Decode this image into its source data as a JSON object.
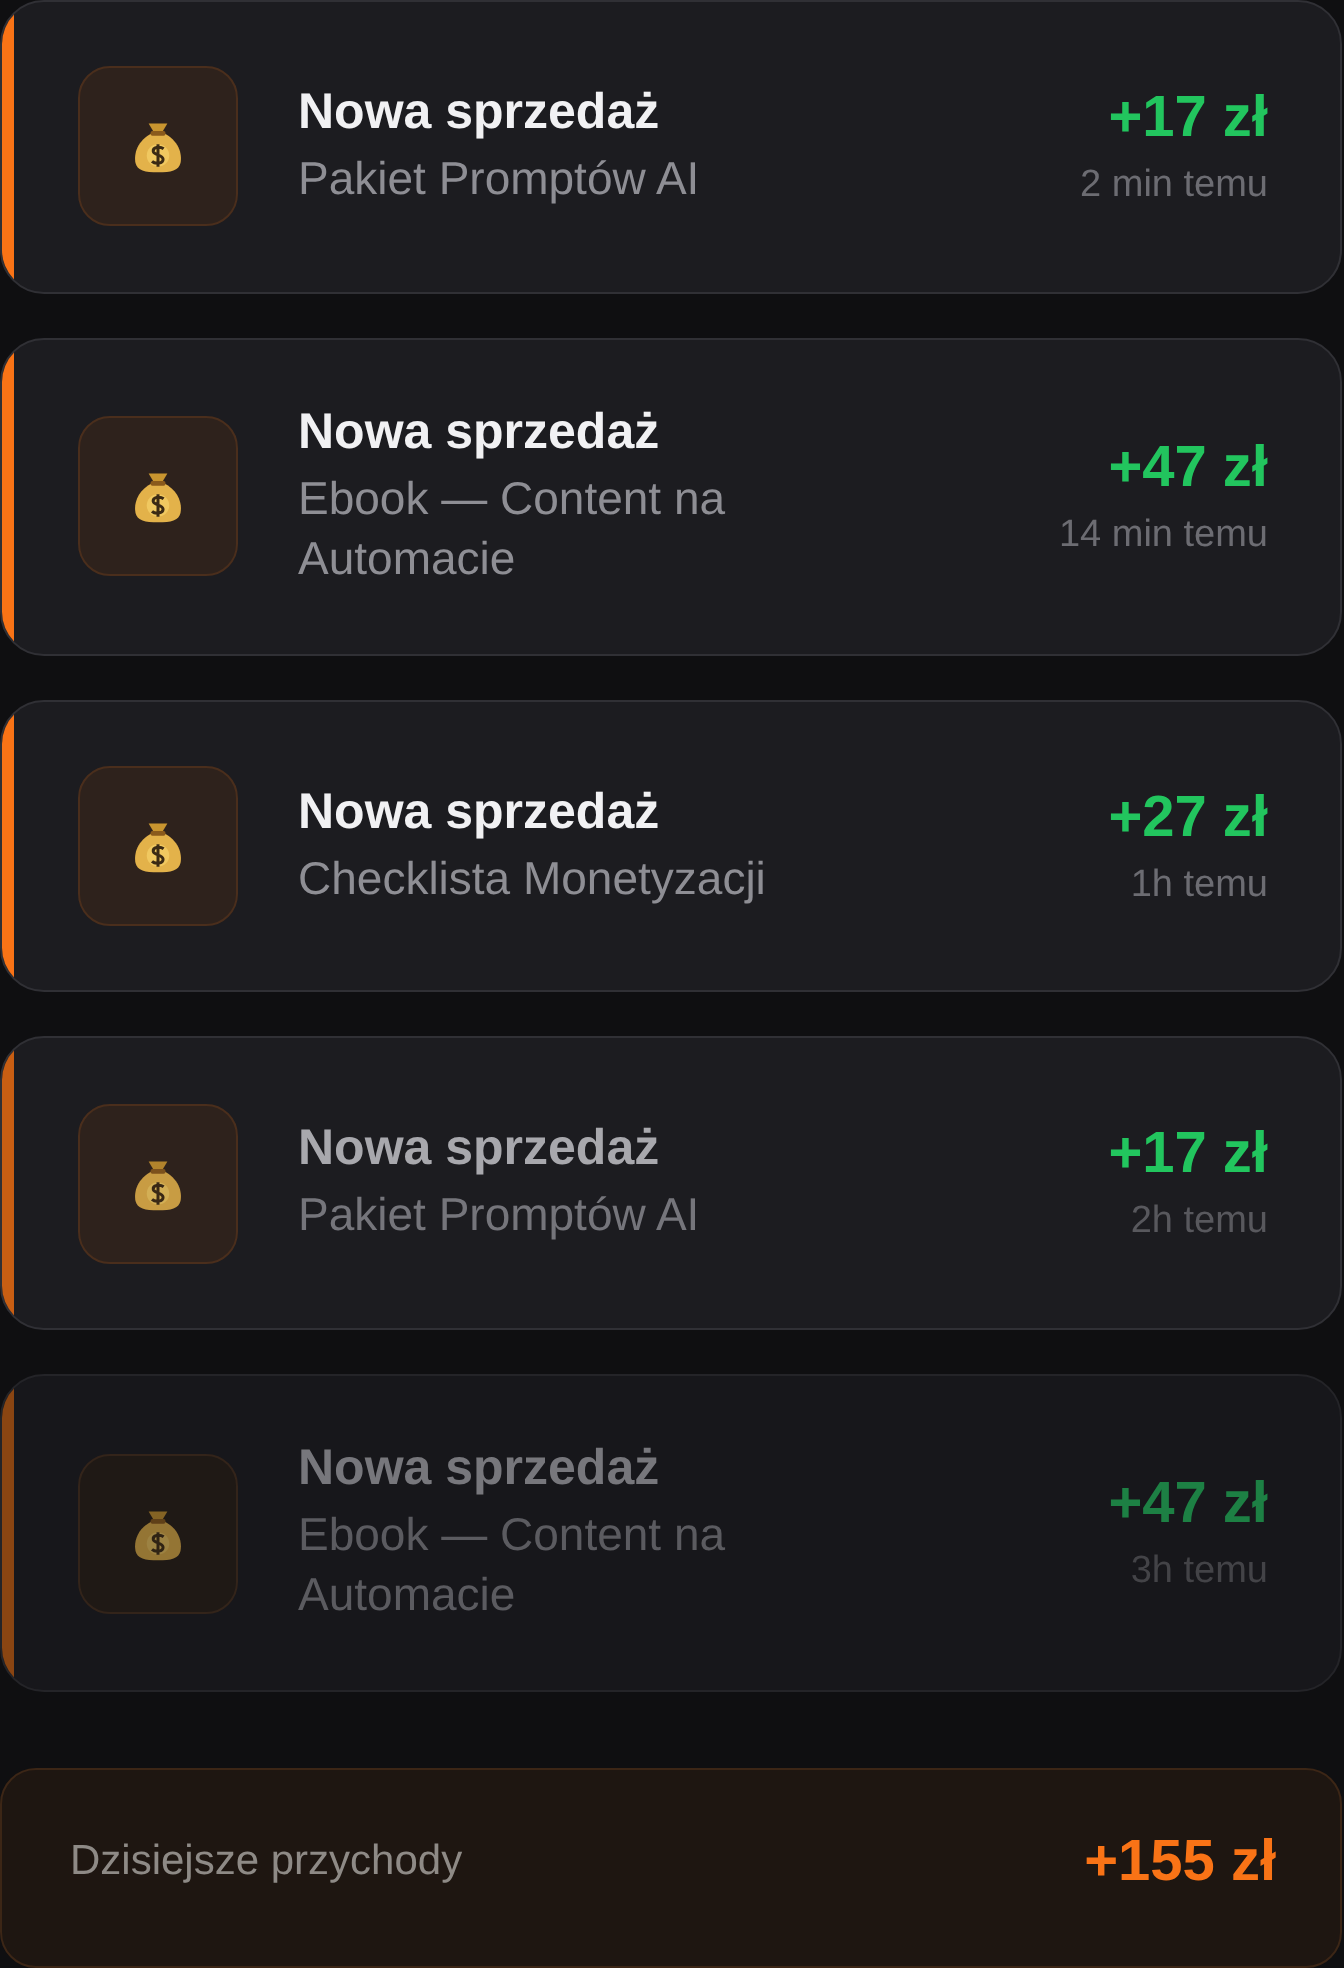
{
  "sales": [
    {
      "title": "Nowa sprzedaż",
      "product": "Pakiet Promptów AI",
      "amount": "+17 zł",
      "time": "2 min temu",
      "kind": "recent"
    },
    {
      "title": "Nowa sprzedaż",
      "product": "Ebook — Content na Automacie",
      "amount": "+47 zł",
      "time": "14 min temu",
      "kind": "recent"
    },
    {
      "title": "Nowa sprzedaż",
      "product": "Checklista Monetyzacji",
      "amount": "+27 zł",
      "time": "1h temu",
      "kind": "recent"
    },
    {
      "title": "Nowa sprzedaż",
      "product": "Pakiet Promptów AI",
      "amount": "+17 zł",
      "time": "2h temu",
      "kind": "older"
    },
    {
      "title": "Nowa sprzedaż",
      "product": "Ebook — Content na Automacie",
      "amount": "+47 zł",
      "time": "3h temu",
      "kind": "oldest"
    }
  ],
  "summary": {
    "label": "Dzisiejsze przychody",
    "amount": "+155 zł"
  }
}
